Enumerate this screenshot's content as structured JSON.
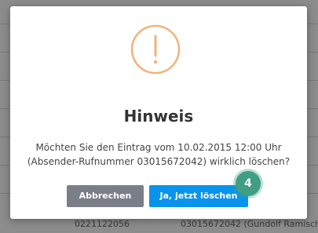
{
  "background": {
    "row_texts": [
      "0221122056",
      "03015672042 (Gundolf Ramisch"
    ]
  },
  "dialog": {
    "icon": "exclamation-circle-icon",
    "title": "Hinweis",
    "message_line1": "Möchten Sie den Eintrag vom 10.02.2015 12:00 Uhr",
    "message_line2": "(Absender-Rufnummer 03015672042) wirklich löschen?",
    "cancel_label": "Abbrechen",
    "confirm_label": "Ja, jetzt löschen",
    "step_badge": "4"
  },
  "colors": {
    "icon": "#f2b27c",
    "cancel": "#7a7f87",
    "confirm": "#0a93ea",
    "badge": "#3f9e83"
  }
}
